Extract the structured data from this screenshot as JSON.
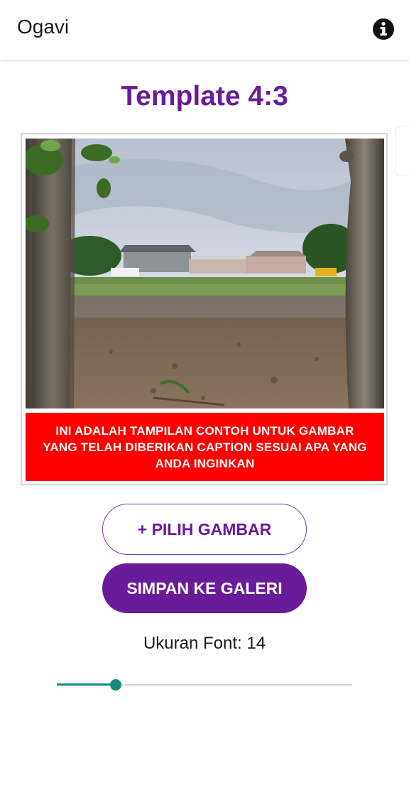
{
  "app": {
    "title": "Ogavi",
    "info_icon": "info-circle-icon"
  },
  "page": {
    "title": "Template 4:3"
  },
  "preview": {
    "photo_description": "field-with-trees-photo",
    "caption": "INI ADALAH TAMPILAN CONTOH UNTUK GAMBAR YANG TELAH DIBERIKAN CAPTION SESUAI APA YANG ANDA INGINKAN",
    "caption_background": "#ff0000",
    "caption_color": "#ffffff"
  },
  "actions": {
    "pick_label": "+ PILIH GAMBAR",
    "save_label": "SIMPAN KE GALERI"
  },
  "font_setting": {
    "label": "Ukuran Font: 14",
    "value": 14,
    "slider_fraction": 0.2
  },
  "colors": {
    "accent": "#6a1b9a",
    "slider": "#138a7a"
  }
}
